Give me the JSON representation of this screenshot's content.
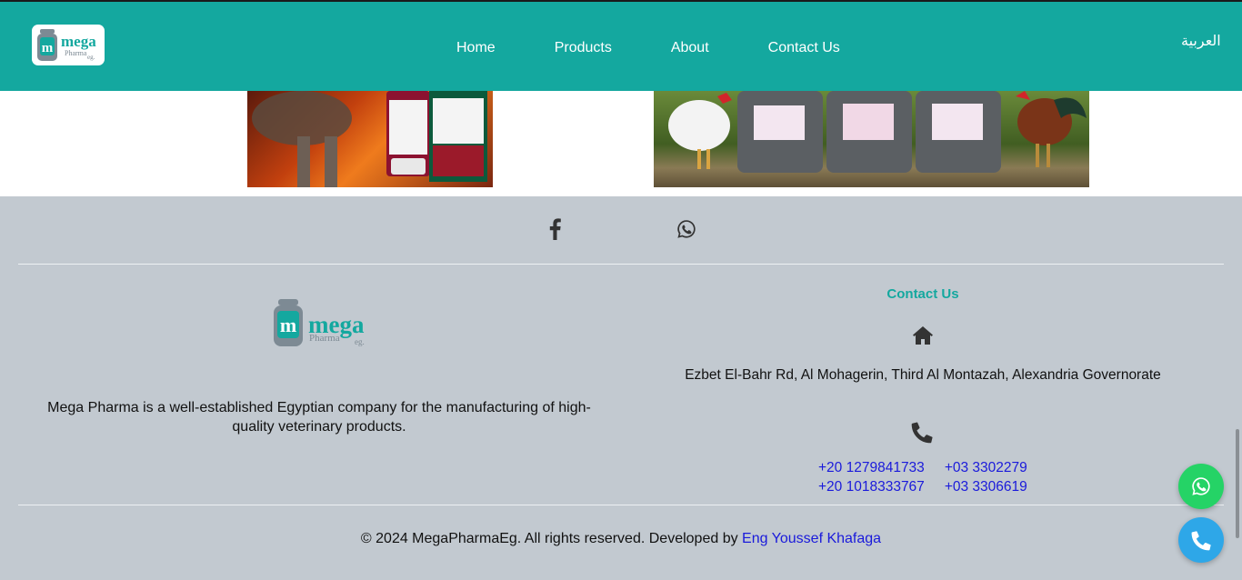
{
  "header": {
    "logo_text": "mega",
    "logo_sub": "Pharma",
    "logo_eg": "eg.",
    "nav": [
      "Home",
      "Products",
      "About",
      "Contact Us"
    ],
    "language": "العربية"
  },
  "banner": {
    "left_image_icon": "product-poultry-image",
    "right_image_icon": "product-jerrycans-poultry-image"
  },
  "social": {
    "facebook_icon": "facebook-icon",
    "whatsapp_icon": "whatsapp-icon"
  },
  "footer": {
    "logo_text": "mega",
    "logo_sub": "Pharma",
    "logo_eg": "eg.",
    "about": "Mega Pharma is a well-established Egyptian company for the manufacturing of high-quality veterinary products.",
    "contact_title": "Contact Us",
    "address": "Ezbet El-Bahr Rd, Al Mohagerin, Third Al Montazah, Alexandria Governorate",
    "phones": [
      "+20 1279841733",
      "+03 3302279",
      "+20 1018333767",
      "+03 3306619"
    ],
    "copyright": "© 2024 MegaPharmaEg. All rights reserved. Developed by",
    "developer": "Eng Youssef Khafaga"
  },
  "colors": {
    "brand": "#14a89f",
    "footer_bg": "#c2c9d0",
    "link": "#1a1adb",
    "whatsapp": "#25d366",
    "call": "#2ea7e8"
  }
}
